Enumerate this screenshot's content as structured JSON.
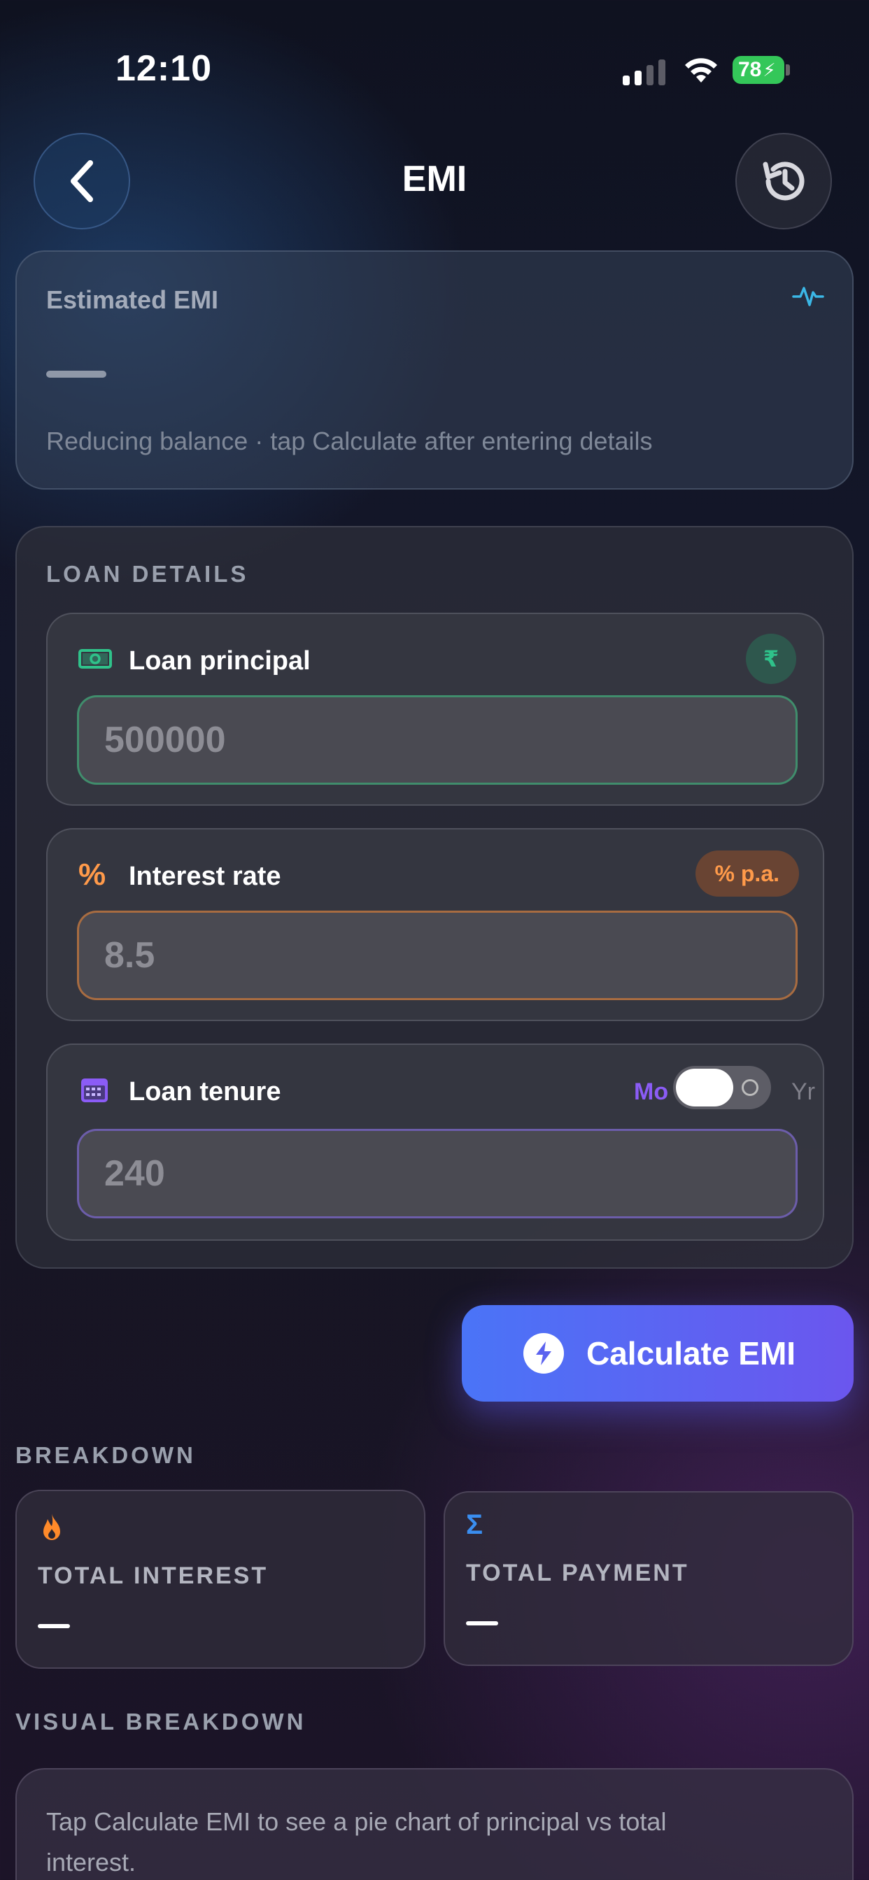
{
  "status_bar": {
    "time": "12:10",
    "battery": "78"
  },
  "nav": {
    "title": "EMI"
  },
  "estimate": {
    "label": "Estimated EMI",
    "note": "Reducing balance · tap Calculate after entering details"
  },
  "loan_details": {
    "title": "LOAN DETAILS",
    "principal": {
      "label": "Loan principal",
      "badge": "₹",
      "placeholder": "500000"
    },
    "rate": {
      "label": "Interest rate",
      "badge": "% p.a.",
      "icon": "%",
      "placeholder": "8.5"
    },
    "tenure": {
      "label": "Loan tenure",
      "toggle_left": "Mo",
      "toggle_right": "Yr",
      "placeholder": "240"
    }
  },
  "calculate": {
    "label": "Calculate EMI"
  },
  "breakdown": {
    "title": "BREAKDOWN",
    "total_interest": {
      "label": "TOTAL INTEREST",
      "icon": "flame-icon"
    },
    "total_payment": {
      "label": "TOTAL PAYMENT",
      "icon": "Σ"
    }
  },
  "visual": {
    "title": "VISUAL BREAKDOWN",
    "text": "Tap Calculate EMI to see a pie chart of principal vs total interest."
  },
  "colors": {
    "accent_green": "#2fc28a",
    "accent_orange": "#ff9a4a",
    "accent_purple": "#8b5cf6",
    "button_gradient_start": "#4a74f7",
    "button_gradient_end": "#6b56ee"
  }
}
